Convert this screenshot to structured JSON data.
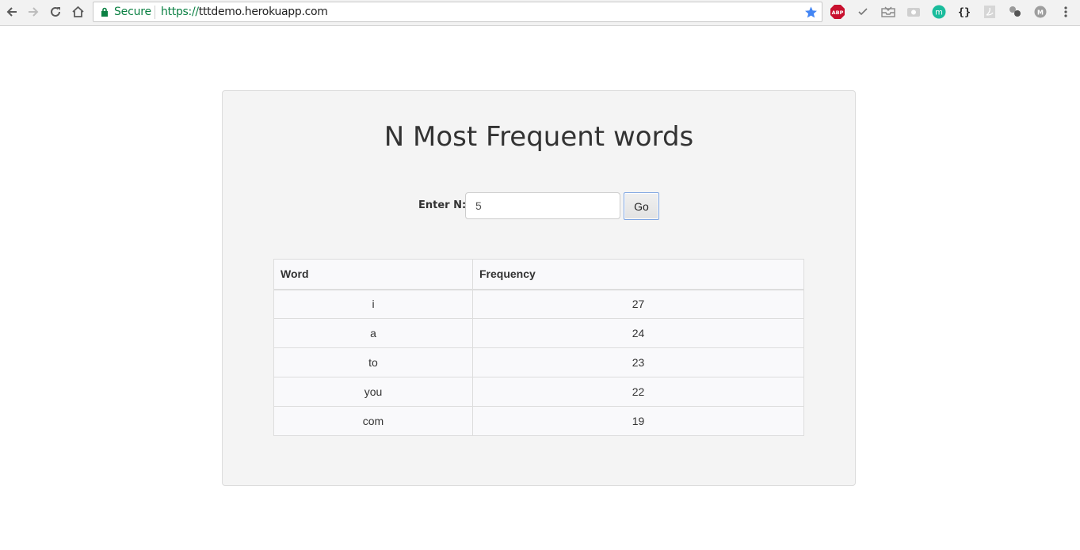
{
  "browser": {
    "secure_label": "Secure",
    "url_scheme": "https://",
    "url_host": "tttdemo.herokuapp.com",
    "extensions": [
      {
        "name": "adblock-icon",
        "label": "ABP"
      },
      {
        "name": "checkmark-icon",
        "label": "✓"
      },
      {
        "name": "inbox-icon"
      },
      {
        "name": "camera-icon"
      },
      {
        "name": "m-extension-icon",
        "label": "m"
      },
      {
        "name": "json-icon",
        "label": "{ }"
      },
      {
        "name": "pdf-icon"
      },
      {
        "name": "gears-icon"
      },
      {
        "name": "profile-icon",
        "label": "M"
      }
    ]
  },
  "page": {
    "title": "N Most Frequent words",
    "form": {
      "label": "Enter N:",
      "value": "5",
      "button": "Go"
    },
    "table": {
      "headers": [
        "Word",
        "Frequency"
      ],
      "rows": [
        {
          "word": "i",
          "frequency": "27"
        },
        {
          "word": "a",
          "frequency": "24"
        },
        {
          "word": "to",
          "frequency": "23"
        },
        {
          "word": "you",
          "frequency": "22"
        },
        {
          "word": "com",
          "frequency": "19"
        }
      ]
    }
  },
  "colors": {
    "secure_green": "#0b8043",
    "card_bg": "#f4f4f4",
    "star_blue": "#4285f4"
  }
}
